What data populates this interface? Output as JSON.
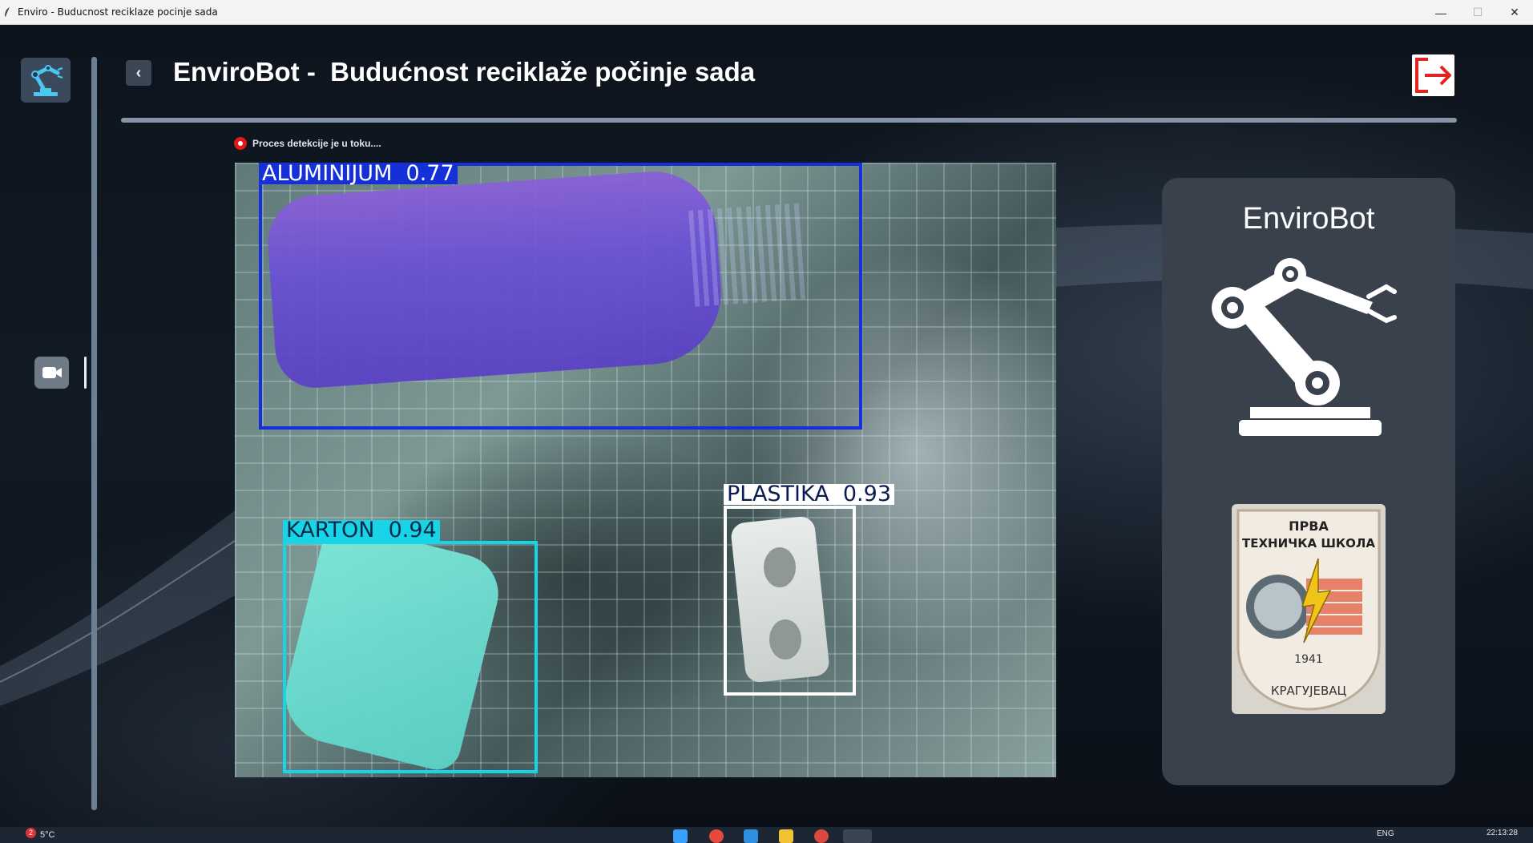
{
  "window": {
    "title": "Enviro - Budućnost reciklaže počinje sada",
    "title_raw": "Enviro - Buducnost reciklaze pocinje sada",
    "minimize_glyph": "—",
    "maximize_glyph": "☐",
    "close_glyph": "✕"
  },
  "header": {
    "back_glyph": "‹",
    "title": "EnviroBot -  Budućnost reciklaže počinje sada"
  },
  "status": {
    "text": "Proces detekcije je u toku...."
  },
  "detections": [
    {
      "label": "ALUMINIJUM  0.77",
      "class": "ALUMINIJUM",
      "score": 0.77,
      "color": "#1530d8"
    },
    {
      "label": "KARTON  0.94",
      "class": "KARTON",
      "score": 0.94,
      "color": "#19d4e6"
    },
    {
      "label": "PLASTIKA  0.93",
      "class": "PLASTIKA",
      "score": 0.93,
      "color": "#ffffff"
    }
  ],
  "panel": {
    "name": "EnviroBot",
    "badge": {
      "line1": "ПРВА",
      "line2": "ТЕХНИЧКА ШКОЛА",
      "year": "1941",
      "city": "КРАГУЈЕВАЦ"
    }
  },
  "taskbar": {
    "notification_count": "2",
    "weather": "5°C",
    "language": "ENG",
    "time": "22:13:28"
  },
  "colors": {
    "exit_icon": "#e32222",
    "status_dot": "#e01818",
    "panel_bg": "#39414c"
  },
  "icons": [
    "robot-arm-icon",
    "camera-icon",
    "back-chevron-icon",
    "exit-icon",
    "school-badge"
  ]
}
